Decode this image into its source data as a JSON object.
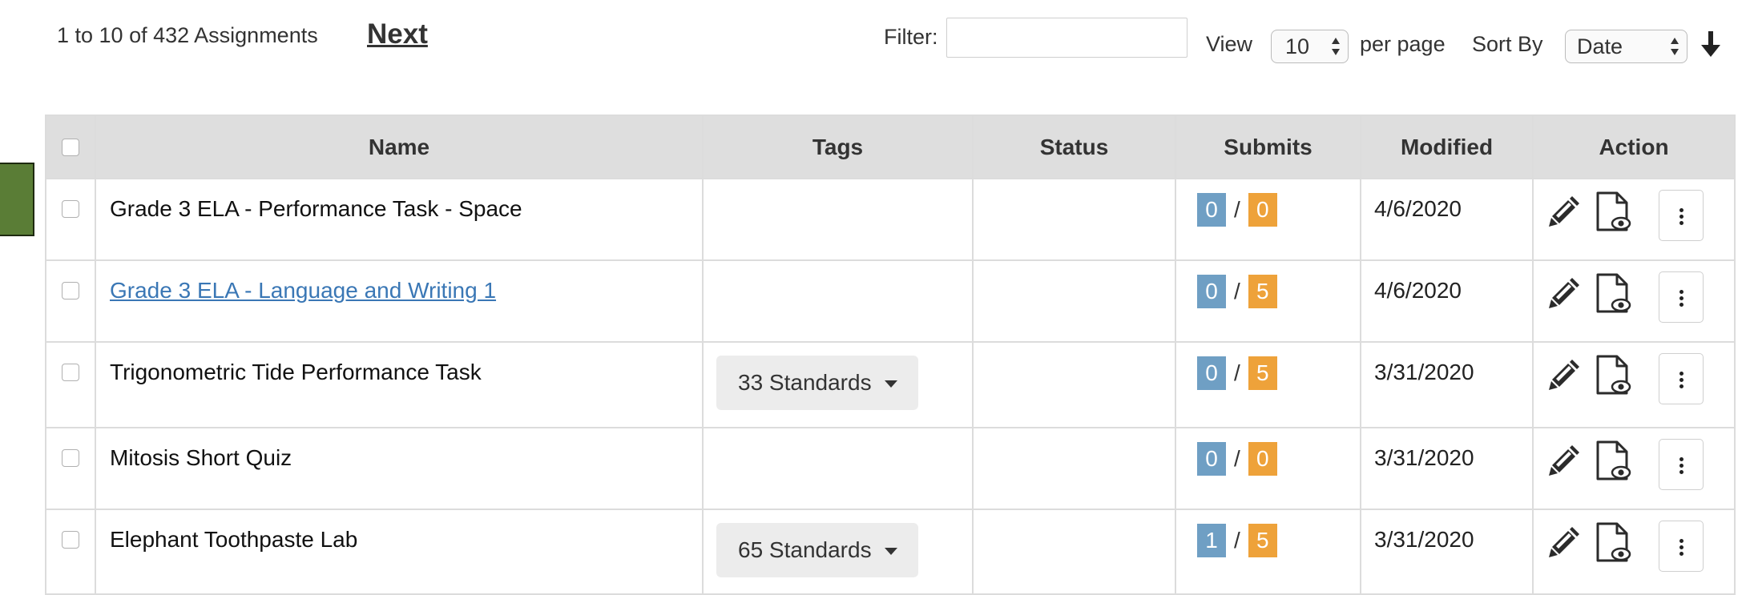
{
  "toolbar": {
    "count_text": "1 to 10 of 432 Assignments",
    "next_label": "Next",
    "filter_label": "Filter:",
    "filter_value": "",
    "view_label": "View",
    "per_page_value": "10",
    "per_page_label": "per page",
    "sort_by_label": "Sort By",
    "sort_by_value": "Date",
    "sort_direction": "descending"
  },
  "table": {
    "columns": [
      "Name",
      "Tags",
      "Status",
      "Submits",
      "Modified",
      "Action"
    ],
    "rows": [
      {
        "name": "Grade 3 ELA - Performance Task - Space",
        "tags": "",
        "status": "",
        "submitted": "0",
        "total": "0",
        "modified": "4/6/2020",
        "is_link": false
      },
      {
        "name": "Grade 3 ELA - Language and Writing 1",
        "tags": "",
        "status": "",
        "submitted": "0",
        "total": "5",
        "modified": "4/6/2020",
        "is_link": true
      },
      {
        "name": "Trigonometric Tide Performance Task",
        "tags": "33 Standards",
        "status": "",
        "submitted": "0",
        "total": "5",
        "modified": "3/31/2020",
        "is_link": false
      },
      {
        "name": "Mitosis Short Quiz",
        "tags": "",
        "status": "",
        "submitted": "0",
        "total": "0",
        "modified": "3/31/2020",
        "is_link": false
      },
      {
        "name": "Elephant Toothpaste Lab",
        "tags": "65 Standards",
        "status": "",
        "submitted": "1",
        "total": "5",
        "modified": "3/31/2020",
        "is_link": false
      }
    ]
  },
  "submits_separator": "/",
  "colors": {
    "submitted_badge": "#6f9fc4",
    "total_badge": "#eea23a",
    "link": "#3a77b5",
    "header_bg": "#dedede",
    "side_tab": "#5a7d36"
  },
  "icons": {
    "edit": "pencil-icon",
    "preview": "document-eye-icon",
    "more": "vertical-ellipsis-icon",
    "sort_direction": "arrow-down-icon"
  }
}
